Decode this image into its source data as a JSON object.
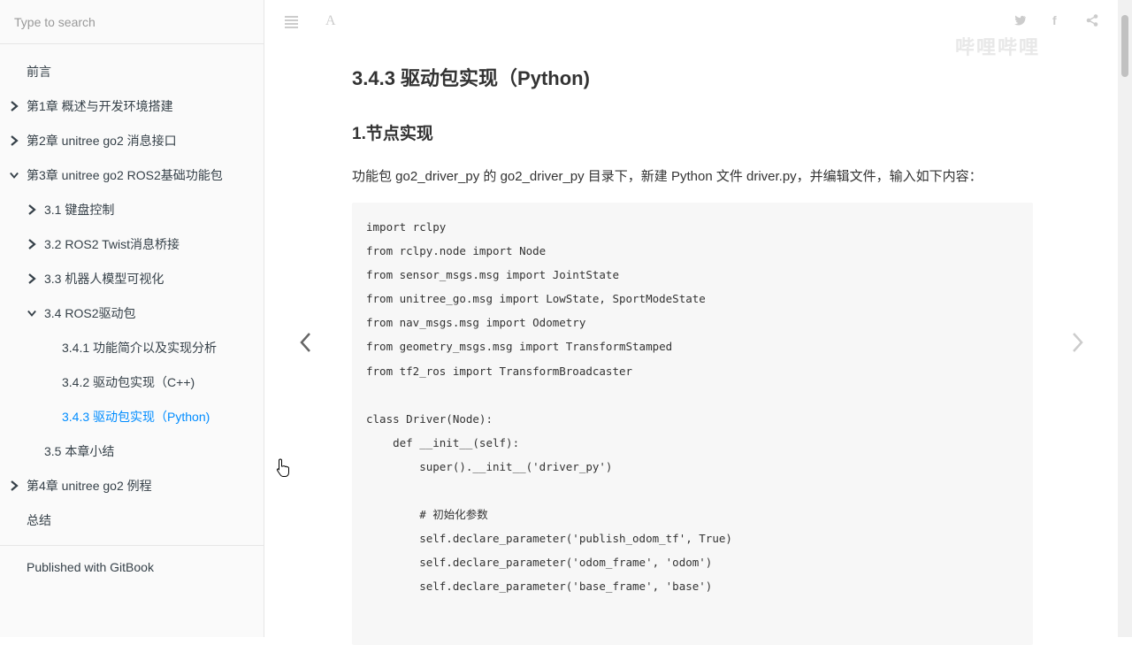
{
  "sidebar": {
    "search_placeholder": "Type to search",
    "items": [
      {
        "label": "前言"
      },
      {
        "label": "第1章 概述与开发环境搭建"
      },
      {
        "label": "第2章 unitree go2 消息接口"
      },
      {
        "label": "第3章 unitree go2 ROS2基础功能包"
      },
      {
        "label": "3.1 键盘控制"
      },
      {
        "label": "3.2 ROS2 Twist消息桥接"
      },
      {
        "label": "3.3 机器人模型可视化"
      },
      {
        "label": "3.4 ROS2驱动包"
      },
      {
        "label": "3.4.1 功能简介以及实现分析"
      },
      {
        "label": "3.4.2 驱动包实现（C++)"
      },
      {
        "label": "3.4.3 驱动包实现（Python)"
      },
      {
        "label": "3.5 本章小结"
      },
      {
        "label": "第4章 unitree go2 例程"
      },
      {
        "label": "总结"
      }
    ],
    "published": "Published with GitBook"
  },
  "page": {
    "title": "3.4.3 驱动包实现（Python)",
    "section": "1.节点实现",
    "description": "功能包 go2_driver_py 的 go2_driver_py 目录下，新建 Python 文件 driver.py，并编辑文件，输入如下内容：",
    "code": "import rclpy\nfrom rclpy.node import Node\nfrom sensor_msgs.msg import JointState\nfrom unitree_go.msg import LowState, SportModeState\nfrom nav_msgs.msg import Odometry\nfrom geometry_msgs.msg import TransformStamped\nfrom tf2_ros import TransformBroadcaster\n\nclass Driver(Node):\n    def __init__(self):\n        super().__init__('driver_py')\n\n        # 初始化参数\n        self.declare_parameter('publish_odom_tf', True)\n        self.declare_parameter('odom_frame', 'odom')\n        self.declare_parameter('base_frame', 'base')"
  },
  "toolbar": {
    "menu_icon": "menu-icon",
    "font_icon": "A",
    "twitter_icon": "twitter-icon",
    "facebook_icon": "f",
    "share_icon": "share-icon"
  },
  "watermark": "哔哩哔哩"
}
